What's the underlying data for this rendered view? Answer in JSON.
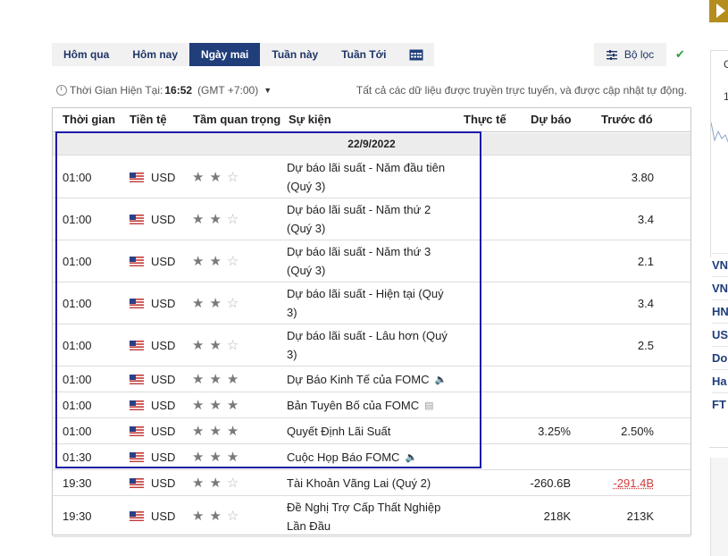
{
  "tabs": [
    {
      "label": "Hôm qua",
      "active": false
    },
    {
      "label": "Hôm nay",
      "active": false
    },
    {
      "label": "Ngày mai",
      "active": true
    },
    {
      "label": "Tuần này",
      "active": false
    },
    {
      "label": "Tuần Tới",
      "active": false
    }
  ],
  "calendar_icon": "calendar-icon",
  "filter": {
    "label": "Bộ lọc",
    "icon": "filter-sliders-icon"
  },
  "check_icon": "check-icon",
  "timebar": {
    "prefix": "Thời Gian Hiện Tại:",
    "time": "16:52",
    "gmt": "(GMT +7:00)",
    "note": "Tất cả các dữ liệu được truyền trực tuyến, và được cập nhật tự động."
  },
  "table": {
    "headers": {
      "time": "Thời gian",
      "currency": "Tiền tệ",
      "importance": "Tầm quan trọng",
      "event": "Sự kiện",
      "actual": "Thực tế",
      "forecast": "Dự báo",
      "previous": "Trước đó"
    },
    "date": "22/9/2022",
    "rows": [
      {
        "time": "01:00",
        "currency": "USD",
        "stars": 2,
        "event": "Dự báo lãi suất - Năm đầu tiên (Quý 3)",
        "actual": "",
        "forecast": "",
        "previous": "3.80"
      },
      {
        "time": "01:00",
        "currency": "USD",
        "stars": 2,
        "event": "Dự báo lãi suất - Năm thứ 2 (Quý 3)",
        "actual": "",
        "forecast": "",
        "previous": "3.4"
      },
      {
        "time": "01:00",
        "currency": "USD",
        "stars": 2,
        "event": "Dự báo lãi suất - Năm thứ 3 (Quý 3)",
        "actual": "",
        "forecast": "",
        "previous": "2.1"
      },
      {
        "time": "01:00",
        "currency": "USD",
        "stars": 2,
        "event": "Dự báo lãi suất - Hiện tại (Quý 3)",
        "actual": "",
        "forecast": "",
        "previous": "3.4"
      },
      {
        "time": "01:00",
        "currency": "USD",
        "stars": 2,
        "event": "Dự báo lãi suất - Lâu hơn (Quý 3)",
        "actual": "",
        "forecast": "",
        "previous": "2.5"
      },
      {
        "time": "01:00",
        "currency": "USD",
        "stars": 3,
        "event": "Dự Báo Kinh Tế của FOMC",
        "icon": "speaker-icon",
        "actual": "",
        "forecast": "",
        "previous": ""
      },
      {
        "time": "01:00",
        "currency": "USD",
        "stars": 3,
        "event": "Bản Tuyên Bố của FOMC",
        "icon": "document-icon",
        "actual": "",
        "forecast": "",
        "previous": ""
      },
      {
        "time": "01:00",
        "currency": "USD",
        "stars": 3,
        "event": "Quyết Định Lãi Suất",
        "actual": "",
        "forecast": "3.25%",
        "previous": "2.50%"
      },
      {
        "time": "01:30",
        "currency": "USD",
        "stars": 3,
        "event": "Cuộc Họp Báo FOMC",
        "icon": "speaker-icon",
        "actual": "",
        "forecast": "",
        "previous": ""
      },
      {
        "time": "19:30",
        "currency": "USD",
        "stars": 2,
        "event": "Tài Khoản Vãng Lai (Quý 2)",
        "actual": "",
        "forecast": "-260.6B",
        "previous": "-291.4B",
        "previous_color": "#d23b3b"
      },
      {
        "time": "19:30",
        "currency": "USD",
        "stars": 2,
        "event": "Đề Nghị Trợ Cấp Thất Nghiệp Lần Đầu",
        "actual": "",
        "forecast": "218K",
        "previous": "213K"
      }
    ]
  },
  "sidebar": {
    "panel_letter": "C",
    "panel_number": "1",
    "items": [
      "VN",
      "VN",
      "HN",
      "US",
      "Do",
      "Ha",
      "FT"
    ]
  },
  "colors": {
    "accent": "#1f3e7a",
    "highlight_box": "#1a1aa8",
    "negative": "#d23b3b",
    "check": "#2e9e3e"
  }
}
